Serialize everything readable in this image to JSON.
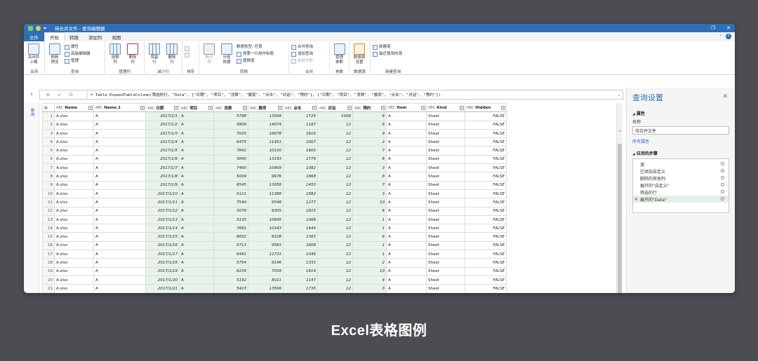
{
  "title": "待合并文件 - 查询编辑器",
  "menu": {
    "file": "文件",
    "tabs": [
      "开始",
      "转换",
      "添加列",
      "视图"
    ]
  },
  "ribbon": {
    "close": {
      "b1": "关闭并",
      "b2": "上载",
      "group": "关闭"
    },
    "query": {
      "refresh": "刷新",
      "preview": "预览",
      "props": "属性",
      "advanced": "高级编辑器",
      "manage": "管理",
      "group": "查询"
    },
    "manage_cols": {
      "choose": "选择",
      "choose2": "列",
      "remove": "删除",
      "remove2": "列",
      "group": "管理列"
    },
    "reduce_rows": {
      "keep": "保留",
      "keep2": "行",
      "remove": "删除",
      "remove2": "行",
      "group": "减少行"
    },
    "sort": {
      "group": "排序"
    },
    "transform": {
      "split": "拆分",
      "split2": "列",
      "groupby": "分组",
      "groupby2": "依据",
      "dtype": "数据类型: 任意",
      "firstrow": "将第一行用作标题",
      "replace": "替换值",
      "group": "转换"
    },
    "combine": {
      "merge": "合并查询",
      "append": "追加查询",
      "files": "合并文件",
      "group": "合并"
    },
    "params": {
      "manage": "管理",
      "manage2": "参数",
      "group": "参数"
    },
    "datasource": {
      "settings": "数据源",
      "settings2": "设置",
      "group": "数据源"
    },
    "newquery": {
      "newsrc": "新建源",
      "recent": "最近使用的源",
      "group": "新建查询"
    }
  },
  "formula": "= Table.ExpandTableColumn(筛选的行, \"Data\", {\"日期\", \"项目\", \"消费\", \"展现\", \"点击\", \"对话\", \"预约\"}, {\"日期\", \"项目\", \"消费\", \"展现\", \"点击\", \"对话\", \"预约\"})",
  "query_strip": "查询",
  "columns": [
    {
      "type": "ABC",
      "name": "Name"
    },
    {
      "type": "ABC",
      "name": "Name.1"
    },
    {
      "type": "ABC",
      "name": "日期"
    },
    {
      "type": "ABC",
      "name": "项目"
    },
    {
      "type": "ABC",
      "name": "消费"
    },
    {
      "type": "ABC",
      "name": "展现"
    },
    {
      "type": "ABC",
      "name": "点击"
    },
    {
      "type": "ABC",
      "name": "对话"
    },
    {
      "type": "ABC",
      "name": "预约"
    },
    {
      "type": "ABC",
      "name": "Item"
    },
    {
      "type": "ABC",
      "name": "Kind"
    },
    {
      "type": "ABC",
      "name": "Hidden"
    }
  ],
  "rows": [
    [
      "1",
      "A.xlsx",
      "A",
      "2017/1/1",
      "A",
      "5798",
      "13508",
      "1725",
      "1008",
      "6",
      "A",
      "Sheet",
      "FALSE"
    ],
    [
      "2",
      "A.xlsx",
      "A",
      "2017/1/2",
      "A",
      "5809",
      "14074",
      "1187",
      "12",
      "6",
      "A",
      "Sheet",
      "FALSE"
    ],
    [
      "3",
      "A.xlsx",
      "A",
      "2017/1/3",
      "A",
      "7025",
      "16678",
      "1616",
      "12",
      "9",
      "A",
      "Sheet",
      "FALSE"
    ],
    [
      "4",
      "A.xlsx",
      "A",
      "2017/1/4",
      "A",
      "6475",
      "11451",
      "1007",
      "12",
      "2",
      "A",
      "Sheet",
      "FALSE"
    ],
    [
      "5",
      "A.xlsx",
      "A",
      "2017/1/5",
      "A",
      "7842",
      "10100",
      "1600",
      "12",
      "7",
      "A",
      "Sheet",
      "FALSE"
    ],
    [
      "6",
      "A.xlsx",
      "A",
      "2017/1/6",
      "A",
      "5840",
      "13193",
      "1779",
      "12",
      "6",
      "A",
      "Sheet",
      "FALSE"
    ],
    [
      "7",
      "A.xlsx",
      "A",
      "2017/1/7",
      "A",
      "7490",
      "10909",
      "1082",
      "12",
      "3",
      "A",
      "Sheet",
      "FALSE"
    ],
    [
      "8",
      "A.xlsx",
      "A",
      "2017/1/8",
      "A",
      "5009",
      "9676",
      "1868",
      "12",
      "8",
      "A",
      "Sheet",
      "FALSE"
    ],
    [
      "9",
      "A.xlsx",
      "A",
      "2017/1/9",
      "A",
      "6545",
      "13058",
      "1453",
      "12",
      "7",
      "A",
      "Sheet",
      "FALSE"
    ],
    [
      "10",
      "A.xlsx",
      "A",
      "2017/1/10",
      "A",
      "5121",
      "11388",
      "1882",
      "12",
      "3",
      "A",
      "Sheet",
      "FALSE"
    ],
    [
      "11",
      "A.xlsx",
      "A",
      "2017/1/11",
      "A",
      "7544",
      "9548",
      "1277",
      "12",
      "10",
      "A",
      "Sheet",
      "FALSE"
    ],
    [
      "12",
      "A.xlsx",
      "A",
      "2017/1/12",
      "A",
      "5079",
      "9305",
      "1815",
      "12",
      "6",
      "A",
      "Sheet",
      "FALSE"
    ],
    [
      "13",
      "A.xlsx",
      "A",
      "2017/1/13",
      "A",
      "5135",
      "10845",
      "1068",
      "12",
      "1",
      "A",
      "Sheet",
      "FALSE"
    ],
    [
      "14",
      "A.xlsx",
      "A",
      "2017/1/14",
      "A",
      "7681",
      "10343",
      "1644",
      "12",
      "1",
      "A",
      "Sheet",
      "FALSE"
    ],
    [
      "15",
      "A.xlsx",
      "A",
      "2017/1/15",
      "A",
      "6832",
      "8108",
      "1365",
      "12",
      "6",
      "A",
      "Sheet",
      "FALSE"
    ],
    [
      "16",
      "A.xlsx",
      "A",
      "2017/1/16",
      "A",
      "5713",
      "9583",
      "1808",
      "12",
      "1",
      "A",
      "Sheet",
      "FALSE"
    ],
    [
      "17",
      "A.xlsx",
      "A",
      "2017/1/17",
      "A",
      "6441",
      "12731",
      "1046",
      "12",
      "1",
      "A",
      "Sheet",
      "FALSE"
    ],
    [
      "18",
      "A.xlsx",
      "A",
      "2017/1/18",
      "A",
      "5754",
      "9146",
      "1333",
      "12",
      "2",
      "A",
      "Sheet",
      "FALSE"
    ],
    [
      "19",
      "A.xlsx",
      "A",
      "2017/1/19",
      "A",
      "6234",
      "7059",
      "1814",
      "12",
      "10",
      "A",
      "Sheet",
      "FALSE"
    ],
    [
      "20",
      "A.xlsx",
      "A",
      "2017/1/20",
      "A",
      "5192",
      "8021",
      "1147",
      "12",
      "4",
      "A",
      "Sheet",
      "FALSE"
    ],
    [
      "21",
      "A.xlsx",
      "A",
      "2017/1/21",
      "A",
      "5423",
      "13566",
      "1735",
      "12",
      "3",
      "A",
      "Sheet",
      "FALSE"
    ]
  ],
  "pane": {
    "title": "查询设置",
    "props_header": "属性",
    "name_label": "名称",
    "name_value": "待合并文件",
    "all_props": "所有属性",
    "steps_header": "应用的步骤",
    "steps": [
      "源",
      "已添加自定义",
      "删除的其他列",
      "展开的\"自定义\"",
      "筛选的行",
      "展开的\"Data\""
    ]
  },
  "caption": "Excel表格图例",
  "colors": {
    "accent": "#2f6fb5",
    "highlight": "#e8f3ea",
    "background": "#4b4d52"
  }
}
